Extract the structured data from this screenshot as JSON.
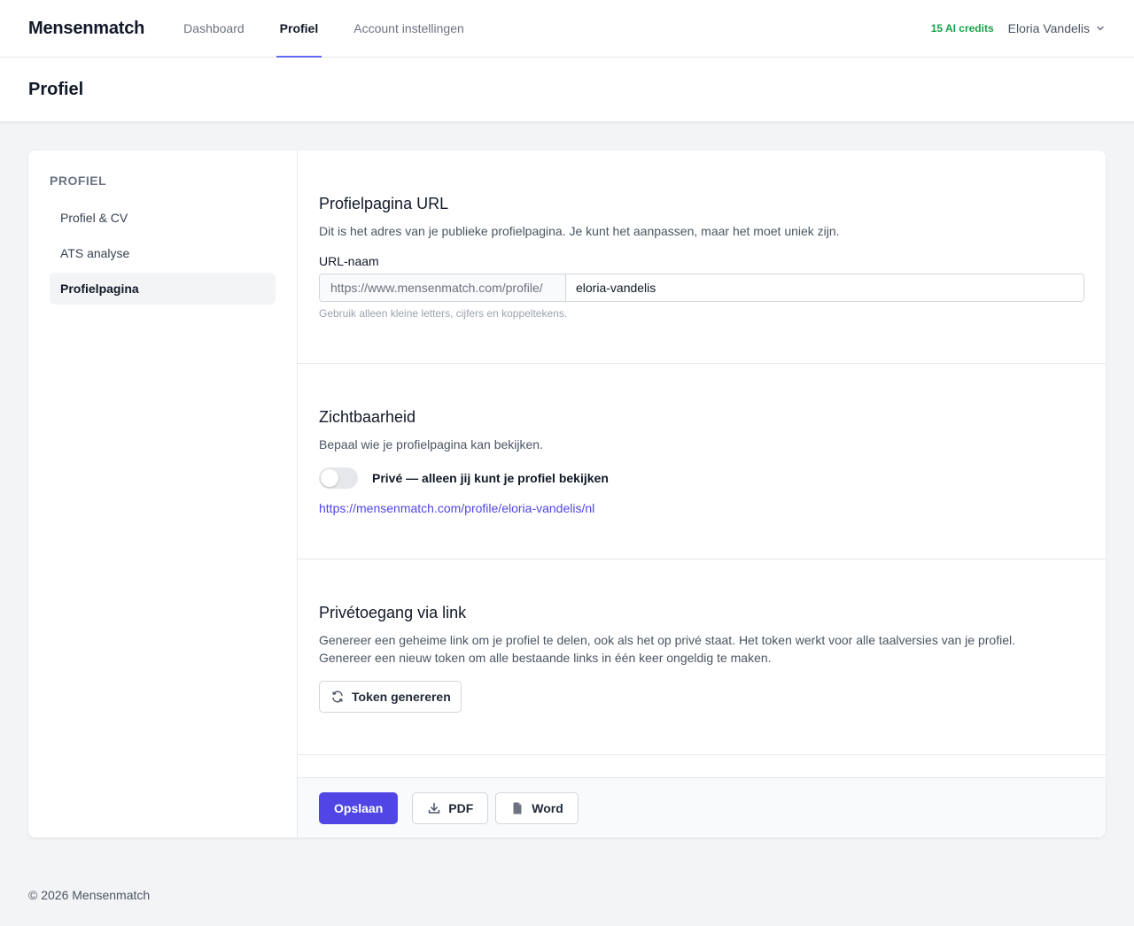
{
  "nav": {
    "brand": "Mensenmatch",
    "links": [
      {
        "label": "Dashboard"
      },
      {
        "label": "Profiel"
      },
      {
        "label": "Account instellingen"
      }
    ],
    "credits": "15 AI credits",
    "user_name": "Eloria Vandelis"
  },
  "header": {
    "title": "Profiel"
  },
  "sidebar": {
    "heading": "PROFIEL",
    "items": [
      {
        "label": "Profiel & CV"
      },
      {
        "label": "ATS analyse"
      },
      {
        "label": "Profielpagina"
      }
    ]
  },
  "url_section": {
    "title": "Profielpagina URL",
    "description": "Dit is het adres van je publieke profielpagina. Je kunt het aanpassen, maar het moet uniek zijn.",
    "field_label": "URL-naam",
    "prefix": "https://www.mensenmatch.com/profile/",
    "value": "eloria-vandelis",
    "hint": "Gebruik alleen kleine letters, cijfers en koppeltekens."
  },
  "visibility_section": {
    "title": "Zichtbaarheid",
    "description": "Bepaal wie je profielpagina kan bekijken.",
    "toggle_label": "Privé — alleen jij kunt je profiel bekijken",
    "toggle_on": false,
    "link": "https://mensenmatch.com/profile/eloria-vandelis/nl"
  },
  "token_section": {
    "title": "Privétoegang via link",
    "description_line1": "Genereer een geheime link om je profiel te delen, ook als het op privé staat. Het token werkt voor alle taalversies van je profiel.",
    "description_line2": "Genereer een nieuw token om alle bestaande links in één keer ongeldig te maken.",
    "button_label": "Token genereren"
  },
  "actions": {
    "save_label": "Opslaan",
    "pdf_label": "PDF",
    "word_label": "Word"
  },
  "footer": {
    "copyright": "© 2026 Mensenmatch"
  },
  "colors": {
    "accent": "#4f46e5",
    "credits": "#16a34a"
  }
}
